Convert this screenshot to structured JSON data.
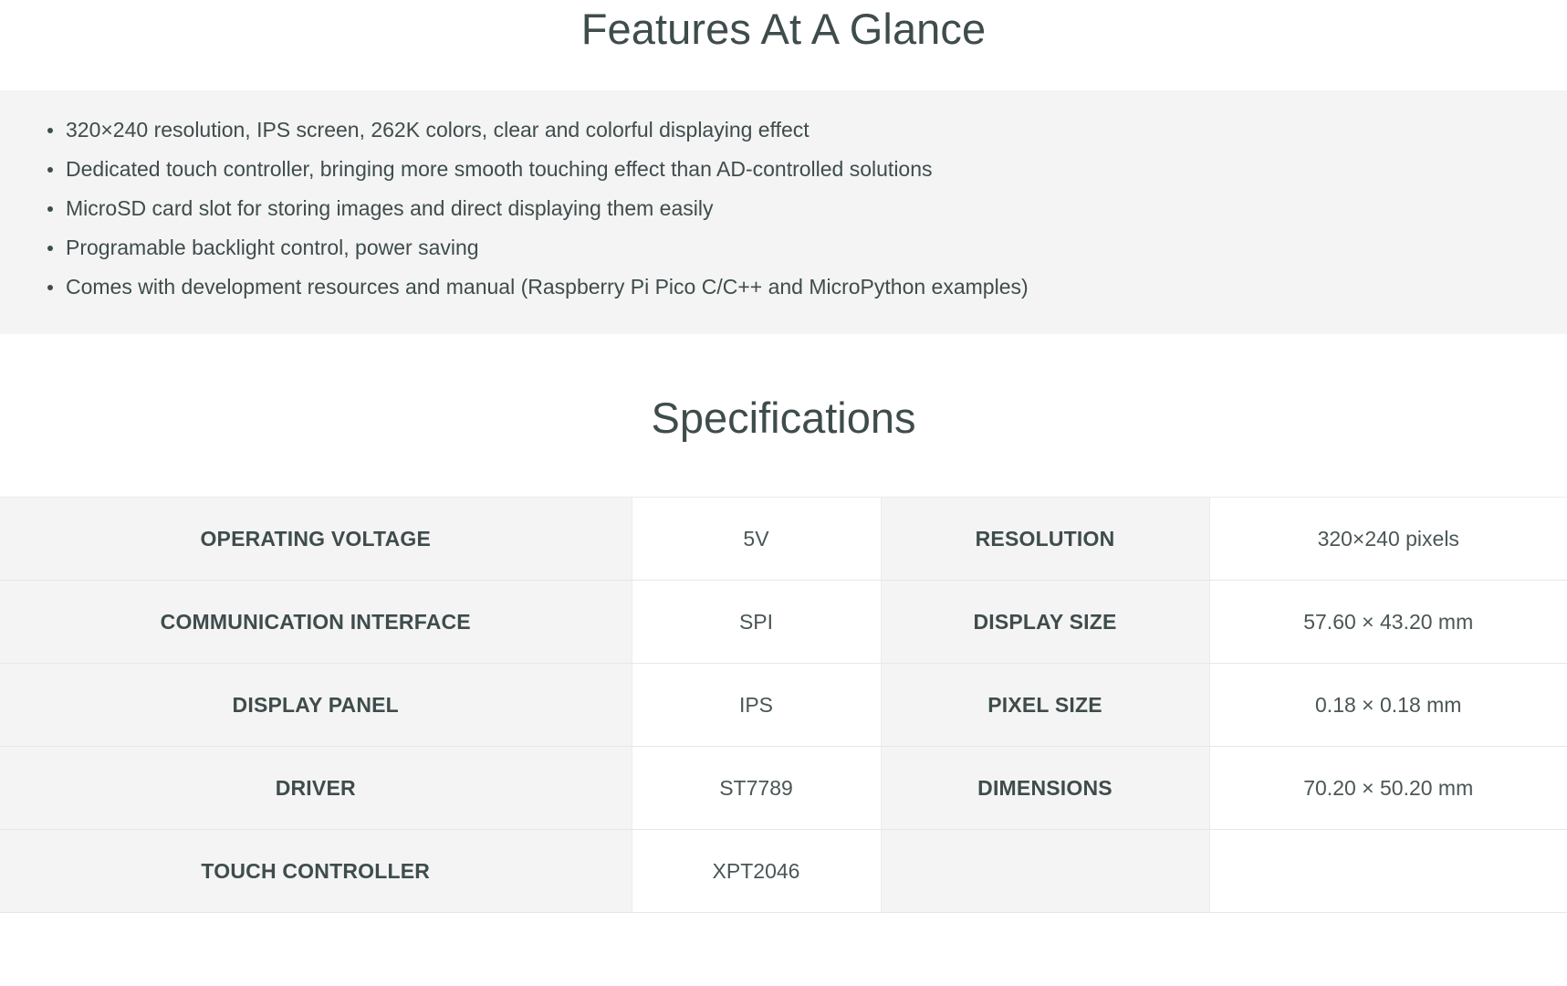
{
  "features": {
    "heading": "Features At A Glance",
    "items": [
      "320×240 resolution, IPS screen, 262K colors, clear and colorful displaying effect",
      "Dedicated touch controller, bringing more smooth touching effect than AD-controlled solutions",
      "MicroSD card slot for storing images and direct displaying them easily",
      "Programable backlight control, power saving",
      "Comes with development resources and manual (Raspberry Pi Pico C/C++ and MicroPython examples)"
    ]
  },
  "specifications": {
    "heading": "Specifications",
    "rows": [
      {
        "label_left": "OPERATING VOLTAGE",
        "value_left": "5V",
        "label_right": "RESOLUTION",
        "value_right": "320×240 pixels"
      },
      {
        "label_left": "COMMUNICATION INTERFACE",
        "value_left": "SPI",
        "label_right": "DISPLAY SIZE",
        "value_right": "57.60 × 43.20 mm"
      },
      {
        "label_left": "DISPLAY PANEL",
        "value_left": "IPS",
        "label_right": "PIXEL SIZE",
        "value_right": "0.18 × 0.18 mm"
      },
      {
        "label_left": "DRIVER",
        "value_left": "ST7789",
        "label_right": "DIMENSIONS",
        "value_right": "70.20 × 50.20 mm"
      },
      {
        "label_left": "TOUCH CONTROLLER",
        "value_left": "XPT2046",
        "label_right": "",
        "value_right": ""
      }
    ]
  },
  "colors": {
    "page_background": "#ffffff",
    "panel_background": "#f4f4f4",
    "text": "#3f4c4c",
    "border": "#e7e7e7"
  }
}
